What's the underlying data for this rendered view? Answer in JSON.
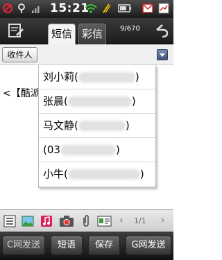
{
  "statusbar": {
    "time": "15:21",
    "icons": [
      "no-signal-icon",
      "location-pin-icon",
      "signal-bars-icon",
      "wifi-icon",
      "sync-icon",
      "battery-icon",
      "email-icon",
      "data-icon"
    ]
  },
  "header": {
    "tabs": [
      {
        "label": "短信",
        "selected": true
      },
      {
        "label": "彩信",
        "selected": false
      }
    ],
    "counter": "9/670",
    "icons": [
      "compose-icon",
      "back-icon"
    ]
  },
  "recipient": {
    "button_label": "收件人",
    "dropdown_icon": "chevron-down-icon"
  },
  "message": {
    "text": "<【酷派"
  },
  "suggestions": [
    {
      "name": "刘小莉(",
      "close": ")"
    },
    {
      "name": "张晨(",
      "close": ")"
    },
    {
      "name": "马文静(",
      "close": ")"
    },
    {
      "name": "(03",
      "close": ")"
    },
    {
      "name": "小牛(",
      "close": ")"
    }
  ],
  "toolbar": {
    "icons": [
      "text-list-icon",
      "image-icon",
      "music-icon",
      "camera-icon",
      "attachment-icon",
      "contact-card-icon"
    ],
    "page_indicator": "1/1",
    "prev": "‹",
    "next": "›"
  },
  "bottom_bar": {
    "buttons": [
      "C网发送",
      "短语",
      "保存",
      "G网发送"
    ]
  },
  "colors": {
    "bar_dark": "#1c1c1c",
    "tab_selected": "#f4f4f4",
    "dropdown_blue": "#42557a"
  }
}
